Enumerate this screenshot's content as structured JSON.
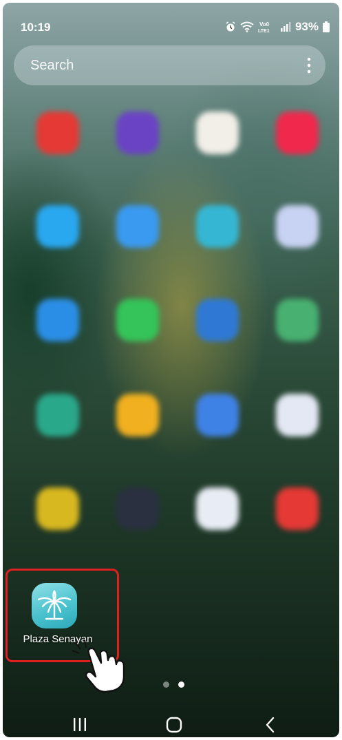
{
  "status": {
    "time": "10:19",
    "network_label": "Vo0 LTE1",
    "battery": "93%"
  },
  "search": {
    "placeholder": "Search"
  },
  "apps": [
    {
      "color": "#e53935",
      "icon": "samsung-video-icon"
    },
    {
      "color": "#6a43c4",
      "icon": "game-launcher-icon"
    },
    {
      "color": "#f2eee8",
      "icon": "samsung-global-goals-icon"
    },
    {
      "color": "#f0284c",
      "icon": "samsung-free-icon"
    },
    {
      "color": "#29a8f0",
      "icon": "samsung-kids-icon"
    },
    {
      "color": "#3a9af0",
      "icon": "app-icon"
    },
    {
      "color": "#35b7d4",
      "icon": "app-icon"
    },
    {
      "color": "#c8d2f2",
      "icon": "teams-icon"
    },
    {
      "color": "#2b8ee6",
      "icon": "app-icon"
    },
    {
      "color": "#34c459",
      "icon": "whatsapp-icon"
    },
    {
      "color": "#2f79d4",
      "icon": "outlook-icon"
    },
    {
      "color": "#48b070",
      "icon": "app-icon"
    },
    {
      "color": "#2aa88a",
      "icon": "app-icon"
    },
    {
      "color": "#f0b020",
      "icon": "app-icon"
    },
    {
      "color": "#3f82e6",
      "icon": "translate-icon"
    },
    {
      "color": "#e4e8f4",
      "icon": "microsoft-365-icon"
    },
    {
      "color": "#d8b820",
      "icon": "app-icon"
    },
    {
      "color": "#2a3040",
      "icon": "speedtest-icon"
    },
    {
      "color": "#e8ecf4",
      "icon": "mrshare-icon"
    },
    {
      "color": "#e53935",
      "icon": "anydesk-icon"
    }
  ],
  "featured_app": {
    "label": "Plaza Senayan",
    "color": "#4cc3cf",
    "icon": "palm-tree-icon",
    "highlight_color": "#e02020"
  },
  "page_indicator": {
    "pages": 2,
    "current": 2
  }
}
